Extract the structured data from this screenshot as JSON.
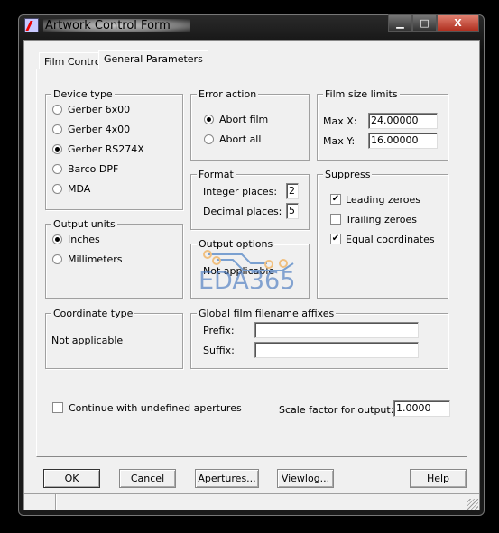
{
  "window": {
    "title": "Artwork Control Form",
    "minimize": "▁",
    "maximize": "□",
    "close": "X"
  },
  "tabs": [
    {
      "label": "Film Control"
    },
    {
      "label": "General Parameters",
      "active": true
    }
  ],
  "device_type": {
    "label": "Device type",
    "options": [
      "Gerber 6x00",
      "Gerber 4x00",
      "Gerber RS274X",
      "Barco DPF",
      "MDA"
    ],
    "selected": "Gerber RS274X"
  },
  "output_units": {
    "label": "Output units",
    "options": [
      "Inches",
      "Millimeters"
    ],
    "selected": "Inches"
  },
  "coordinate_type": {
    "label": "Coordinate type",
    "value": "Not applicable"
  },
  "error_action": {
    "label": "Error action",
    "options": [
      "Abort film",
      "Abort all"
    ],
    "selected": "Abort film"
  },
  "format": {
    "label": "Format",
    "integer_label": "Integer places:",
    "integer_value": "2",
    "decimal_label": "Decimal places:",
    "decimal_value": "5"
  },
  "output_options": {
    "label": "Output options",
    "value": "Not applicable"
  },
  "film_size": {
    "label": "Film size limits",
    "maxx_label": "Max X:",
    "maxx_value": "24.00000",
    "maxy_label": "Max Y:",
    "maxy_value": "16.00000"
  },
  "suppress": {
    "label": "Suppress",
    "items": [
      {
        "label": "Leading zeroes",
        "checked": true
      },
      {
        "label": "Trailing zeroes",
        "checked": false
      },
      {
        "label": "Equal coordinates",
        "checked": true
      }
    ]
  },
  "affixes": {
    "label": "Global film filename affixes",
    "prefix_label": "Prefix:",
    "prefix_value": "",
    "suffix_label": "Suffix:",
    "suffix_value": ""
  },
  "continue_undefined": {
    "label": "Continue with undefined apertures",
    "checked": false
  },
  "scale": {
    "label": "Scale factor for output:",
    "value": "1.0000"
  },
  "buttons": {
    "ok": "OK",
    "cancel": "Cancel",
    "apertures": "Apertures...",
    "viewlog": "Viewlog...",
    "help": "Help"
  },
  "watermark": "EDA365"
}
